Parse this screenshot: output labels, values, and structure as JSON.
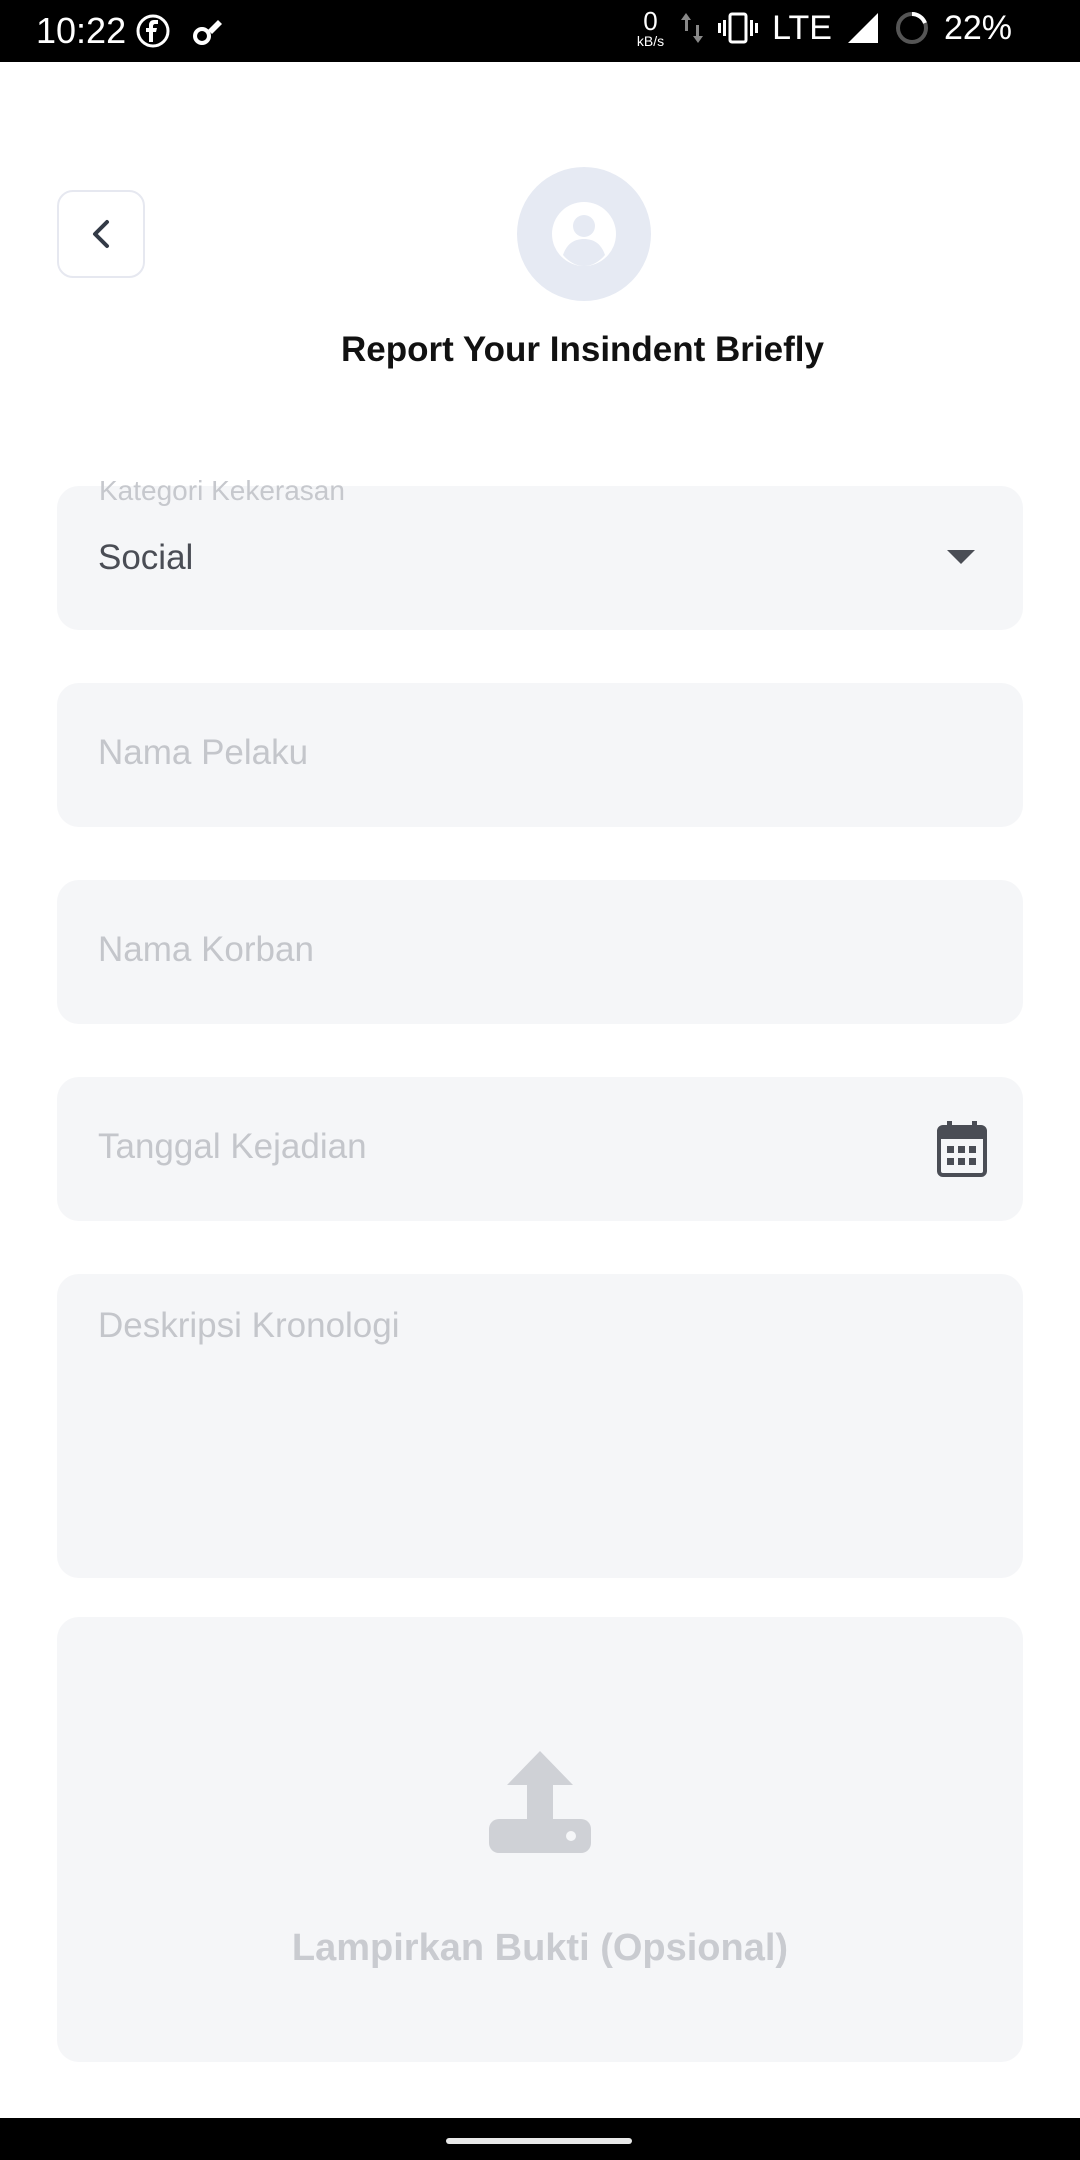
{
  "status_bar": {
    "time": "10:22",
    "net_speed_value": "0",
    "net_speed_unit": "kB/s",
    "network": "LTE",
    "battery": "22%",
    "icons": [
      "facebook-icon",
      "tools-icon",
      "data-arrows-icon",
      "vibrate-icon",
      "signal-icon",
      "battery-icon"
    ]
  },
  "header": {
    "back_icon": "chevron-left-icon",
    "avatar_icon": "user-icon",
    "title": "Report Your Insindent Briefly"
  },
  "form": {
    "category": {
      "label": "Kategori Kekerasan",
      "value": "Social"
    },
    "perpetrator_placeholder": "Nama Pelaku",
    "victim_placeholder": "Nama Korban",
    "date_placeholder": "Tanggal Kejadian",
    "description_placeholder": "Deskripsi Kronologi",
    "upload_label": "Lampirkan Bukti (Opsional)"
  },
  "colors": {
    "field_bg": "#f5f6f8",
    "placeholder": "#c4c6cb",
    "text": "#4a4d55",
    "avatar_bg": "#e6eaf3"
  }
}
